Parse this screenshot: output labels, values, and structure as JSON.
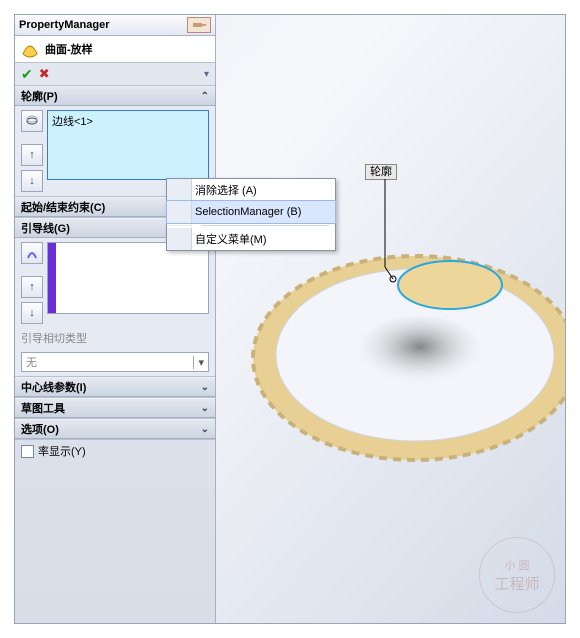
{
  "pm": {
    "title": "PropertyManager",
    "feature": "曲面-放样",
    "profiles": {
      "header": "轮廓(P)",
      "items": [
        "边线<1>"
      ]
    },
    "constraints": {
      "header": "起始/结束约束(C)"
    },
    "guides": {
      "header": "引导线(G)",
      "tangent_label": "引导相切类型",
      "tangent_value": "无"
    },
    "centerline": {
      "header": "中心线参数(I)"
    },
    "sketchtools": {
      "header": "草图工具"
    },
    "options": {
      "header": "选项(O)"
    },
    "curvature": {
      "label": "率显示(Y)"
    }
  },
  "context_menu": {
    "items": [
      "消除选择 (A)",
      "SelectionManager (B)",
      "自定义菜单(M)"
    ],
    "selected_index": 1
  },
  "callout": "轮廓",
  "watermark": {
    "l1": "小 圆",
    "l2": "工程师"
  }
}
